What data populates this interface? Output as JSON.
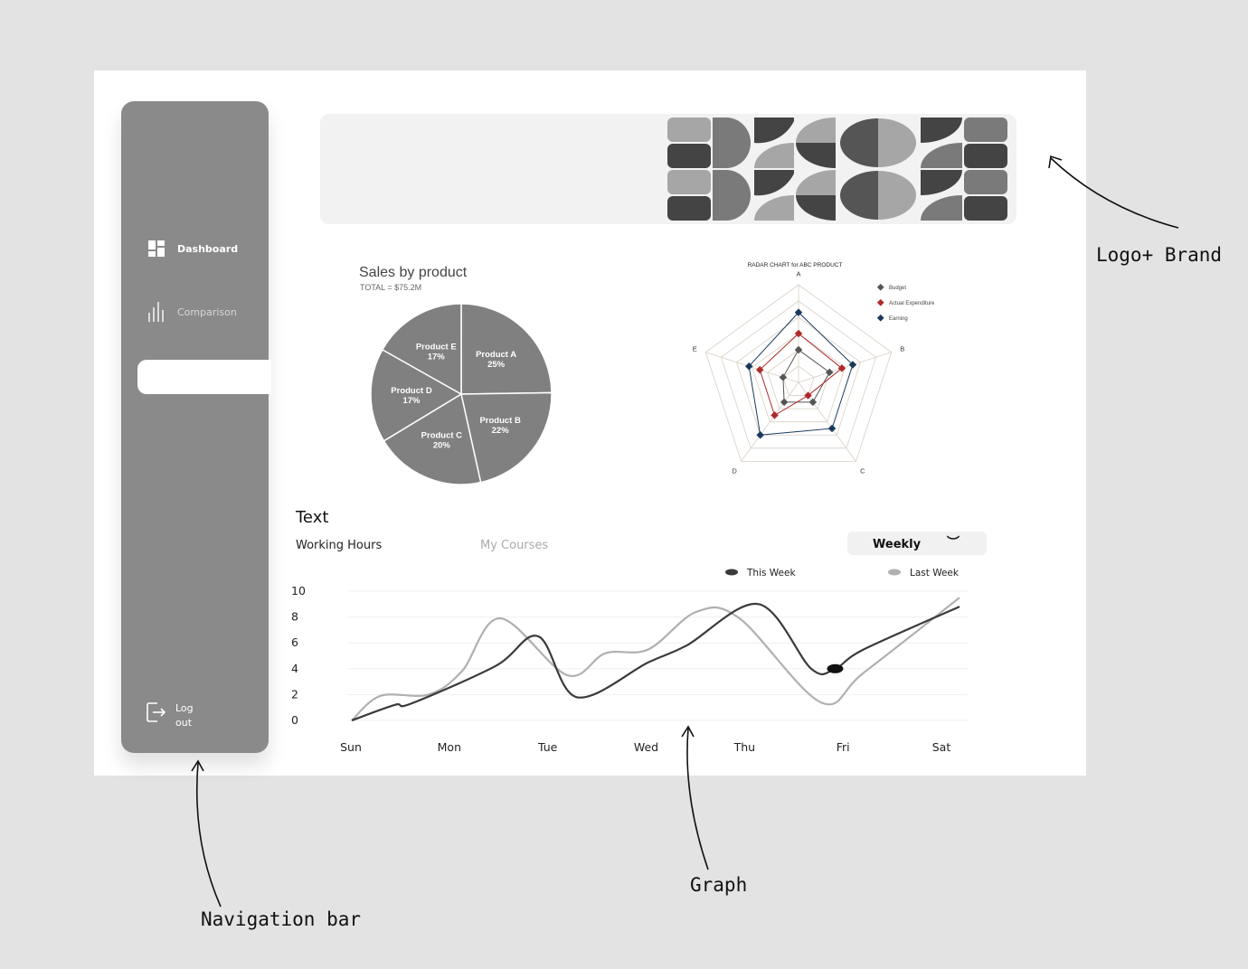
{
  "sidebar": {
    "items": [
      {
        "label": "Dashboard",
        "icon": "dashboard-icon"
      },
      {
        "label": "Comparison",
        "icon": "bar-chart-icon"
      }
    ],
    "logout_line1": "Log",
    "logout_line2": "out",
    "background": "#8a8a8a"
  },
  "pie": {
    "chart_data": {
      "type": "pie",
      "title": "Sales by product",
      "subtitle": "TOTAL = $75.2M",
      "slices": [
        {
          "label": "Product A",
          "value": 25
        },
        {
          "label": "Product B",
          "value": 22
        },
        {
          "label": "Product C",
          "value": 20
        },
        {
          "label": "Product D",
          "value": 17
        },
        {
          "label": "Product E",
          "value": 17
        }
      ],
      "color": "#808080"
    }
  },
  "radar": {
    "chart_data": {
      "type": "radar",
      "title": "RADAR CHART for ABC PRODUCT",
      "axes": [
        "A",
        "B",
        "C",
        "D",
        "E"
      ],
      "series": [
        {
          "name": "Budget",
          "color": "#555555",
          "values": [
            2,
            2,
            1.5,
            1.5,
            1
          ]
        },
        {
          "name": "Actual Expenditure",
          "color": "#b02a2a",
          "values": [
            3,
            2.8,
            1,
            2.5,
            2.5
          ]
        },
        {
          "name": "Earning",
          "color": "#1a3a5c",
          "values": [
            4.3,
            3.5,
            3.5,
            4,
            3.2
          ]
        }
      ],
      "max": 6
    }
  },
  "main": {
    "section_title": "Text",
    "tabs": [
      "Working Hours",
      "My Courses"
    ],
    "period": "Weekly",
    "chart_data": {
      "type": "line",
      "categories": [
        "Sun",
        "Mon",
        "Tue",
        "Wed",
        "Thu",
        "Fri",
        "Sat"
      ],
      "y_ticks": [
        "10",
        "8",
        "6",
        "4",
        "2",
        "0"
      ],
      "ylim": [
        0,
        10
      ],
      "series": [
        {
          "name": "This Week",
          "color": "#3a3a3a",
          "x": [
            0,
            0.45,
            0.62,
            1.5,
            1.95,
            2.35,
            3.1,
            3.5,
            4.25,
            4.8,
            5.05,
            5.35,
            6.35
          ],
          "y": [
            0,
            1.2,
            1.3,
            4.2,
            6.5,
            1.8,
            4.5,
            5.8,
            9.0,
            4.0,
            4.0,
            5.5,
            8.8
          ]
        },
        {
          "name": "Last Week",
          "color": "#b0b0b0",
          "x": [
            0,
            0.3,
            0.8,
            1.15,
            1.55,
            2.25,
            2.65,
            3.1,
            3.6,
            4.05,
            4.9,
            5.35,
            6.35
          ],
          "y": [
            0,
            1.9,
            2.0,
            3.8,
            7.9,
            3.5,
            5.2,
            5.5,
            8.4,
            7.9,
            1.4,
            3.7,
            9.5
          ]
        }
      ],
      "highlight": {
        "x": 5.05,
        "y": 4.0
      }
    }
  },
  "annotations": {
    "logo": "Logo+ Brand",
    "graph": "Graph",
    "nav": "Navigation bar"
  }
}
